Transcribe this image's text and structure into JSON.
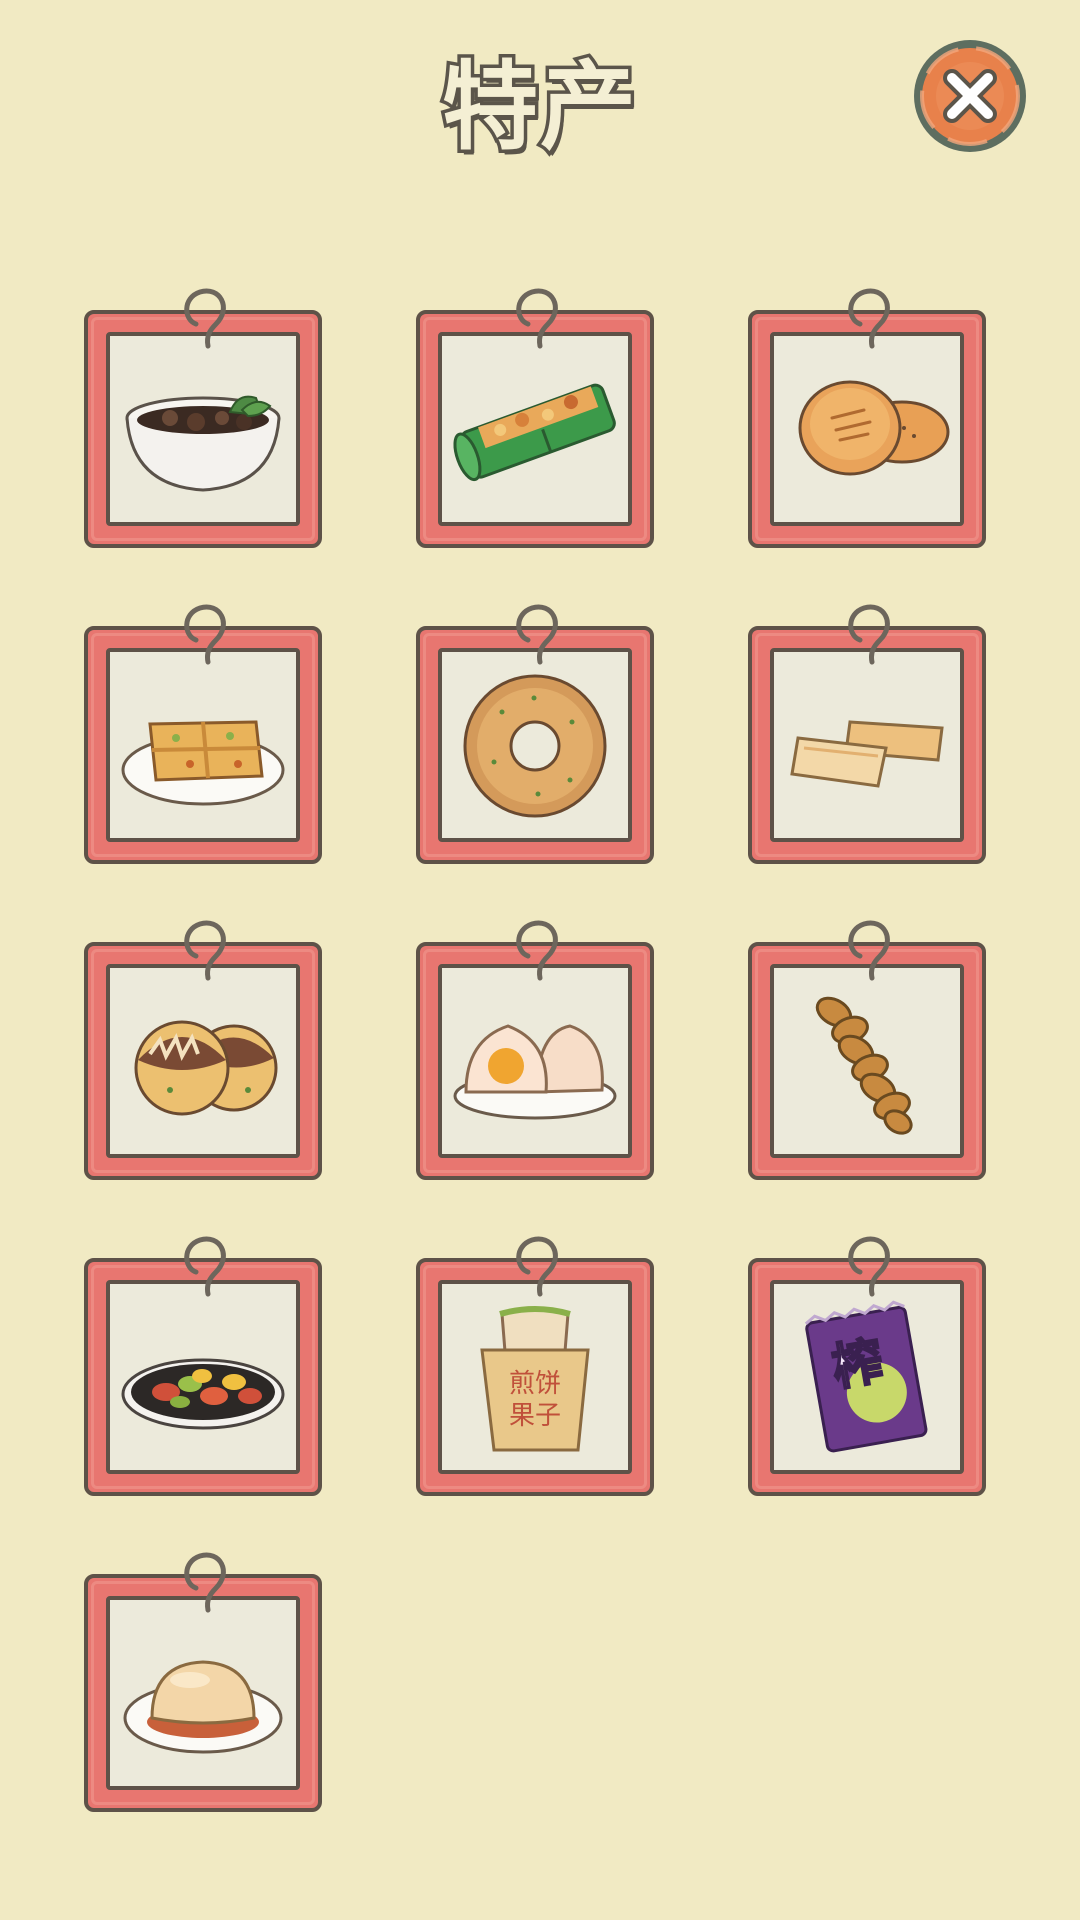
{
  "header": {
    "title": "特产"
  },
  "close_button": {
    "icon": "close-icon",
    "colors": {
      "ring": "#5e6e60",
      "fill": "#e8814b",
      "cross": "#ffffff"
    }
  },
  "colors": {
    "background": "#f1eac3",
    "card_frame": "#e87670",
    "card_border": "#5e5248",
    "card_inner": "#eceadb"
  },
  "specialties": [
    {
      "id": "bowl-soup",
      "icon": "herbal-soup-bowl-icon"
    },
    {
      "id": "bamboo-rice",
      "icon": "bamboo-tube-rice-icon"
    },
    {
      "id": "baked-cakes",
      "icon": "baked-flatbread-icon"
    },
    {
      "id": "fried-tofu",
      "icon": "fried-tofu-plate-icon"
    },
    {
      "id": "donut",
      "icon": "sesame-ring-donut-icon"
    },
    {
      "id": "cake-bars",
      "icon": "cake-bars-icon"
    },
    {
      "id": "takoyaki",
      "icon": "takoyaki-icon"
    },
    {
      "id": "buns",
      "icon": "egg-yolk-buns-icon"
    },
    {
      "id": "twist",
      "icon": "fried-dough-twist-icon"
    },
    {
      "id": "stir-fry",
      "icon": "stir-fry-dish-icon"
    },
    {
      "id": "jianbing",
      "icon": "jianbing-guozi-icon",
      "label_line1": "煎饼",
      "label_line2": "果子"
    },
    {
      "id": "zhacai",
      "icon": "zhacai-pickle-pack-icon",
      "label": "榨"
    },
    {
      "id": "pudding",
      "icon": "steamed-pudding-icon"
    }
  ]
}
